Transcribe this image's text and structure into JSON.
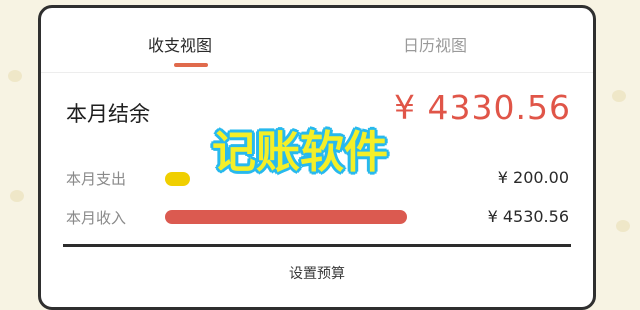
{
  "tabs": [
    {
      "label": "收支视图",
      "active": true
    },
    {
      "label": "日历视图",
      "active": false
    }
  ],
  "summary": {
    "balance_label": "本月结余",
    "balance_value": "¥ 4330.56",
    "expense_label": "本月支出",
    "expense_value": "¥ 200.00",
    "income_label": "本月收入",
    "income_value": "¥ 4530.56"
  },
  "footer": {
    "budget_button": "设置预算"
  },
  "overlay": {
    "title": "记账软件"
  },
  "colors": {
    "accent": "#e05548",
    "expense_bar": "#f0cf00",
    "income_bar": "#db5a50",
    "overlay_text": "#f4ef28",
    "overlay_outline": "#27b9ee"
  }
}
